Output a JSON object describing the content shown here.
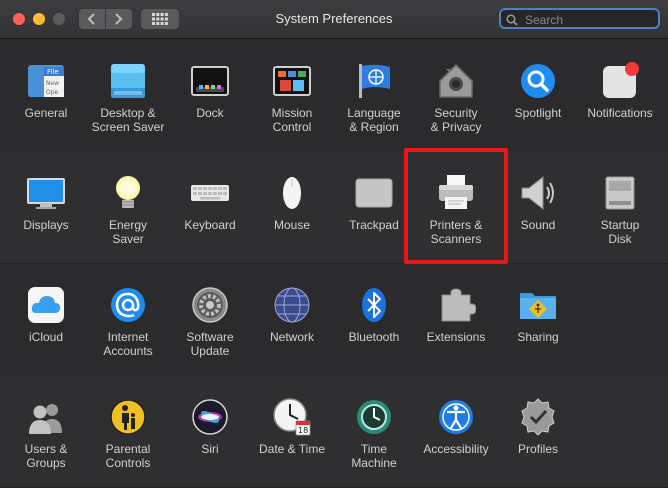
{
  "window": {
    "title": "System Preferences"
  },
  "toolbar": {
    "back_icon": "chevron-left-icon",
    "forward_icon": "chevron-right-icon",
    "show_all_icon": "grid-icon",
    "search_placeholder": "Search"
  },
  "rows": [
    {
      "panes": [
        {
          "id": "general",
          "label": "General",
          "icon": "general-icon"
        },
        {
          "id": "desktop-screen-saver",
          "label": "Desktop &\nScreen Saver",
          "icon": "desktop-icon"
        },
        {
          "id": "dock",
          "label": "Dock",
          "icon": "dock-icon"
        },
        {
          "id": "mission-control",
          "label": "Mission\nControl",
          "icon": "mission-control-icon"
        },
        {
          "id": "language-region",
          "label": "Language\n& Region",
          "icon": "flag-icon"
        },
        {
          "id": "security-privacy",
          "label": "Security\n& Privacy",
          "icon": "house-lock-icon"
        },
        {
          "id": "spotlight",
          "label": "Spotlight",
          "icon": "magnifier-icon"
        },
        {
          "id": "notifications",
          "label": "Notifications",
          "icon": "notification-icon"
        }
      ]
    },
    {
      "panes": [
        {
          "id": "displays",
          "label": "Displays",
          "icon": "display-icon"
        },
        {
          "id": "energy-saver",
          "label": "Energy\nSaver",
          "icon": "lightbulb-icon"
        },
        {
          "id": "keyboard",
          "label": "Keyboard",
          "icon": "keyboard-icon"
        },
        {
          "id": "mouse",
          "label": "Mouse",
          "icon": "mouse-icon"
        },
        {
          "id": "trackpad",
          "label": "Trackpad",
          "icon": "trackpad-icon"
        },
        {
          "id": "printers-scanners",
          "label": "Printers &\nScanners",
          "icon": "printer-icon"
        },
        {
          "id": "sound",
          "label": "Sound",
          "icon": "speaker-icon"
        },
        {
          "id": "startup-disk",
          "label": "Startup\nDisk",
          "icon": "disk-icon"
        }
      ]
    },
    {
      "panes": [
        {
          "id": "icloud",
          "label": "iCloud",
          "icon": "cloud-icon"
        },
        {
          "id": "internet-accounts",
          "label": "Internet\nAccounts",
          "icon": "at-sign-icon"
        },
        {
          "id": "software-update",
          "label": "Software\nUpdate",
          "icon": "gear-icon"
        },
        {
          "id": "network",
          "label": "Network",
          "icon": "globe-icon"
        },
        {
          "id": "bluetooth",
          "label": "Bluetooth",
          "icon": "bluetooth-icon"
        },
        {
          "id": "extensions",
          "label": "Extensions",
          "icon": "puzzle-icon"
        },
        {
          "id": "sharing",
          "label": "Sharing",
          "icon": "folder-sharing-icon"
        }
      ]
    },
    {
      "panes": [
        {
          "id": "users-groups",
          "label": "Users &\nGroups",
          "icon": "users-icon"
        },
        {
          "id": "parental-controls",
          "label": "Parental\nControls",
          "icon": "parental-icon"
        },
        {
          "id": "siri",
          "label": "Siri",
          "icon": "siri-icon"
        },
        {
          "id": "date-time",
          "label": "Date & Time",
          "icon": "clock-icon"
        },
        {
          "id": "time-machine",
          "label": "Time\nMachine",
          "icon": "time-machine-icon"
        },
        {
          "id": "accessibility",
          "label": "Accessibility",
          "icon": "accessibility-icon"
        },
        {
          "id": "profiles",
          "label": "Profiles",
          "icon": "badge-check-icon"
        }
      ]
    }
  ],
  "annotation": {
    "highlighted_pane": "printers-scanners",
    "color": "#e8171a"
  },
  "general_icon_text": [
    "File",
    "New",
    "Ope"
  ],
  "date_icon_day": "18",
  "colors": {
    "accent": "#4d80c4",
    "window_bg": "#2b2b2d"
  }
}
